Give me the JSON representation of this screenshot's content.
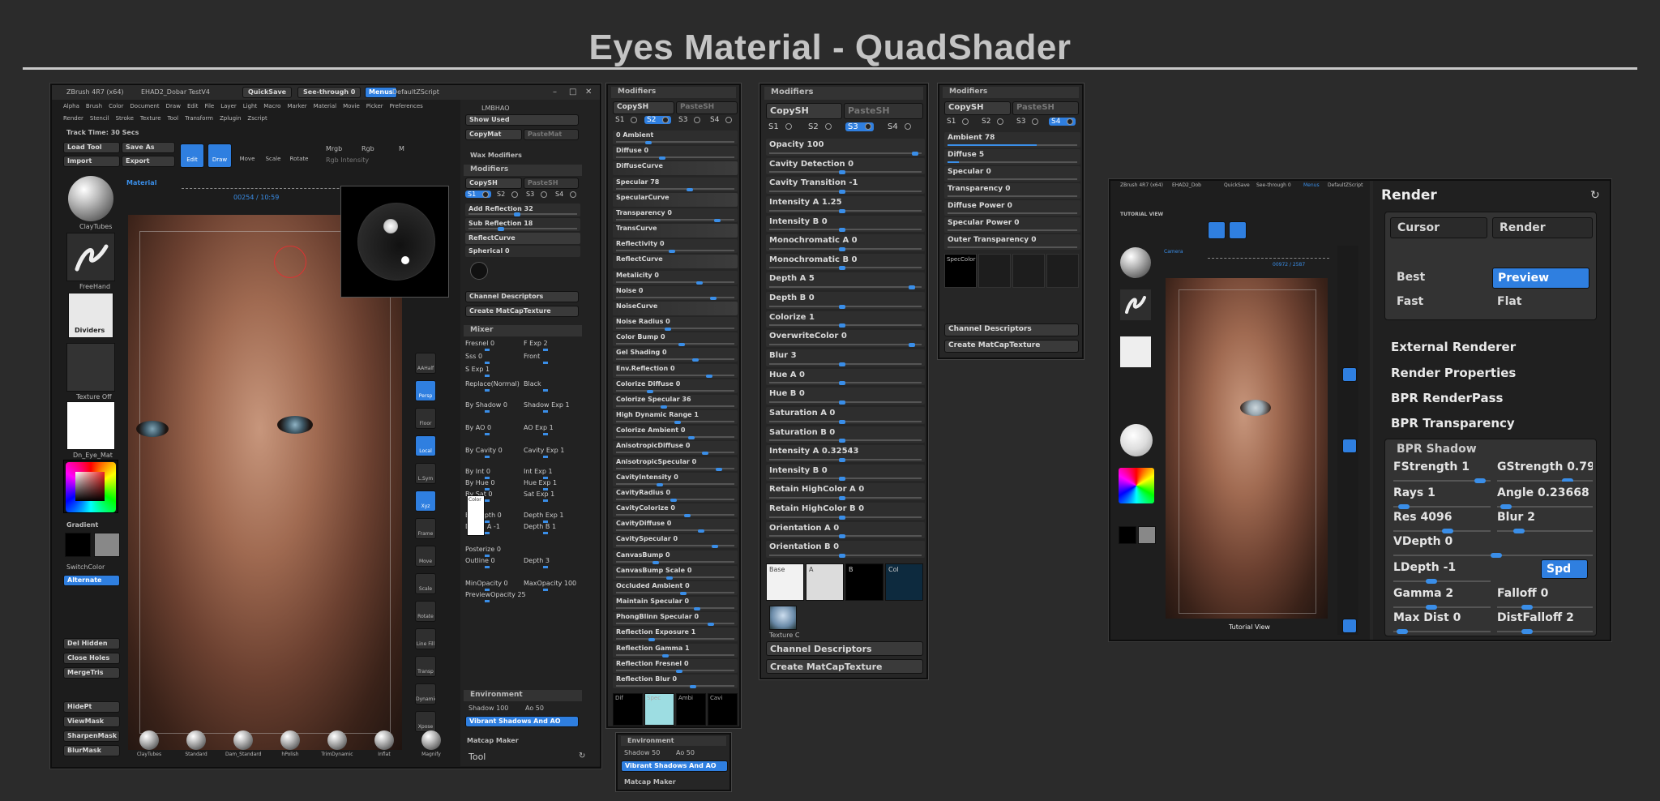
{
  "title": "Eyes Material - QuadShader",
  "zbrush_main": {
    "title_bar": "ZBrush 4R7 (x64)",
    "doc_name": "EHAD2_Dobar TestV4",
    "quicksave": "QuickSave",
    "see_through": "See-through  0",
    "menus": "Menus",
    "default_script": "DefaultZScript",
    "menu_row1": [
      "Alpha",
      "Brush",
      "Color",
      "Document",
      "Draw",
      "Edit",
      "File",
      "Layer",
      "Light",
      "Macro",
      "Marker",
      "Material",
      "Movie",
      "Picker",
      "Preferences"
    ],
    "menu_row2": [
      "Render",
      "Stencil",
      "Stroke",
      "Texture",
      "Tool",
      "Transform",
      "Zplugin",
      "Zscript"
    ],
    "track_time": "Track Time: 30 Secs",
    "load_tool": "Load Tool",
    "save_as": "Save As",
    "import": "Import",
    "export": "Export",
    "edit": "Edit",
    "draw": "Draw",
    "move": "Move",
    "scale": "Scale",
    "rotate": "Rotate",
    "mrgb": "Mrgb",
    "rgb": "Rgb",
    "m": "M",
    "rgb_intensity": "Rgb Intensity",
    "material_label": "Material",
    "timeline_value": "00254 / 10:59",
    "left_items": [
      "ClayTubes",
      "FreeHand",
      "Dividers",
      "Texture Off",
      "Dn_Eye_Mat"
    ],
    "gradient": "Gradient",
    "switch_color": "SwitchColor",
    "alternate": "Alternate",
    "del_hidden": "Del Hidden",
    "close_holes": "Close Holes",
    "merge_tris": "MergeTris",
    "hide_pt": "HidePt",
    "view_mask": "ViewMask",
    "sharpen_mask": "SharpenMask",
    "blur_mask": "BlurMask",
    "right_tools": [
      "AAHalf",
      "Persp",
      "Floor",
      "Local",
      "L.Sym",
      "Xyz",
      "Frame",
      "Move",
      "Scale",
      "Rotate",
      "Line Fill PolyF",
      "Transp",
      "Dynamic Solo",
      "Xpose"
    ],
    "brushes": [
      "ClayTubes",
      "Standard",
      "Dam_Standard",
      "hPolish",
      "TrimDynamic",
      "Inflat",
      "Magnify"
    ],
    "matcap_label": "LMBHAO",
    "show_used": "Show Used",
    "copy_mat": "CopyMat",
    "paste_mat": "PasteMat",
    "wax_modifiers": "Wax Modifiers",
    "modifiers": "Modifiers",
    "copy_sh": "CopySH",
    "paste_sh": "PasteSH",
    "s_tabs": [
      "S1",
      "S2",
      "S3",
      "S4"
    ],
    "add_reflection": "Add Reflection 32",
    "sub_reflection": "Sub Reflection 18",
    "reflect_curve": "ReflectCurve",
    "spherical": "Spherical 0",
    "channel_descriptors": "Channel Descriptors",
    "create_matcap": "Create MatCapTexture",
    "mixer": "Mixer",
    "mixer_rows": [
      [
        "Fresnel 0",
        "F Exp 2"
      ],
      [
        "Sss 0",
        "Front"
      ],
      [
        "S Exp 1",
        ""
      ],
      [
        "Replace(Normal)",
        "Black"
      ],
      [
        "By Shadow 0",
        "Shadow Exp 1"
      ],
      [
        "By AO 0",
        "AO Exp 1"
      ],
      [
        "By Cavity 0",
        "Cavity Exp 1"
      ],
      [
        "By Int 0",
        "Int Exp 1"
      ],
      [
        "By Hue 0",
        "Hue Exp 1"
      ],
      [
        "By Sat 0",
        "Sat Exp 1"
      ],
      [
        "By Depth 0",
        "Depth Exp 1"
      ],
      [
        "Depth A -1",
        "Depth B 1"
      ],
      [
        "Posterize 0",
        ""
      ],
      [
        "Outline 0",
        "Depth 3"
      ],
      [
        "MinOpacity 0",
        "MaxOpacity 100"
      ],
      [
        "PreviewOpacity 25",
        ""
      ]
    ],
    "color_label": "Color",
    "environment": "Environment",
    "shadow": "Shadow 100",
    "ao": "Ao 50",
    "vibrant": "Vibrant Shadows And AO",
    "matcap_maker": "Matcap Maker",
    "tool": "Tool"
  },
  "panel2": {
    "header": "Modifiers",
    "copy_sh": "CopySH",
    "paste_sh": "PasteSH",
    "s_tabs": [
      "S1",
      "S2",
      "S3",
      "S4"
    ],
    "rows": [
      "0 Ambient",
      "Diffuse 0",
      "DiffuseCurve",
      "Specular 78",
      "SpecularCurve",
      "Transparency 0",
      "TransCurve",
      "Reflectivity 0",
      "ReflectCurve",
      "Metalicity 0",
      "Noise 0",
      "NoiseCurve",
      "Noise Radius 0",
      "Color Bump 0",
      "Gel Shading 0",
      "Env.Reflection 0",
      "Colorize Diffuse 0",
      "Colorize Specular 36",
      "High Dynamic Range 1",
      "Colorize Ambient 0",
      "AnisotropicDiffuse 0",
      "AnisotropicSpecular 0",
      "CavityIntensity 0",
      "CavityRadius 0",
      "CavityColorize 0",
      "CavityDiffuse 0",
      "CavitySpecular 0",
      "CanvasBump 0",
      "CanvasBump Scale 0",
      "Occluded  Ambient 0",
      "Maintain Specular 0",
      "PhongBlinn Specular 0",
      "Reflection Exposure 1",
      "Reflection Gamma 1",
      "Reflection Fresnel 0",
      "Reflection Blur 0"
    ],
    "swatches": [
      "Dif",
      "Spec",
      "Ambi",
      "Cavi"
    ],
    "environment": "Environment",
    "shadow": "Shadow 50",
    "ao": "Ao 50",
    "vibrant": "Vibrant Shadows And AO",
    "matcap_maker": "Matcap Maker"
  },
  "panel3": {
    "header": "Modifiers",
    "copy_sh": "CopySH",
    "paste_sh": "PasteSH",
    "s_tabs": [
      "S1",
      "S2",
      "S3",
      "S4"
    ],
    "rows": [
      "Opacity 100",
      "Cavity Detection 0",
      "Cavity Transition -1",
      "Intensity A 1.25",
      "Intensity B 0",
      "Monochromatic A 0",
      "Monochromatic B 0",
      "Depth A 5",
      "Depth B 0",
      "Colorize 1",
      "OverwriteColor 0",
      "Blur 3",
      "Hue A 0",
      "Hue B 0",
      "Saturation A 0",
      "Saturation B 0",
      "Intensity A 0.32543",
      "Intensity B 0",
      "Retain HighColor A 0",
      "Retain HighColor B 0",
      "Orientation A 0",
      "Orientation B 0"
    ],
    "swatches": [
      "Base",
      "A",
      "B",
      "Col"
    ],
    "texture": "Texture C",
    "channel_descriptors": "Channel Descriptors",
    "create_matcap": "Create MatCapTexture"
  },
  "panel4": {
    "header": "Modifiers",
    "copy_sh": "CopySH",
    "paste_sh": "PasteSH",
    "s_tabs": [
      "S1",
      "S2",
      "S3",
      "S4"
    ],
    "rows": [
      "Ambient 78",
      "Diffuse 5",
      "Specular 0",
      "Transparency 0",
      "Diffuse Power 0",
      "Specular Power 0",
      "Outer Transparency 0"
    ],
    "spec_color": "SpecColor",
    "channel_descriptors": "Channel Descriptors",
    "create_matcap": "Create MatCapTexture"
  },
  "panel5": {
    "render_title": "Render",
    "cursor": "Cursor",
    "render_btn": "Render",
    "best": "Best",
    "preview": "Preview",
    "fast": "Fast",
    "flat": "Flat",
    "external_renderer": "External Renderer",
    "render_properties": "Render Properties",
    "bpr_renderpass": "BPR RenderPass",
    "bpr_transparency": "BPR Transparency",
    "bpr_shadow": "BPR Shadow",
    "fstrength": "FStrength 1",
    "gstrength": "GStrength 0.79",
    "rays": "Rays 1",
    "angle": "Angle 0.23668",
    "res": "Res 4096",
    "blur": "Blur 2",
    "vdepth": "VDepth 0",
    "ldepth": "LDepth -1",
    "spd": "Spd",
    "gamma": "Gamma 2",
    "falloff": "Falloff 0",
    "max_dist": "Max Dist 0",
    "dist_falloff": "DistFalloff 2",
    "mini_title": "ZBrush 4R7 (x64)",
    "mini_doc": "EHAD2_Dob",
    "mini_quicksave": "QuickSave",
    "mini_see": "See-through 0",
    "mini_menus": "Menus",
    "mini_script": "DefaultZScript",
    "tutorial_view": "TUTORIAL VIEW",
    "tutorial_view2": "Tutorial View",
    "camera": "Camera",
    "mini_time": "00972 / 2587"
  }
}
